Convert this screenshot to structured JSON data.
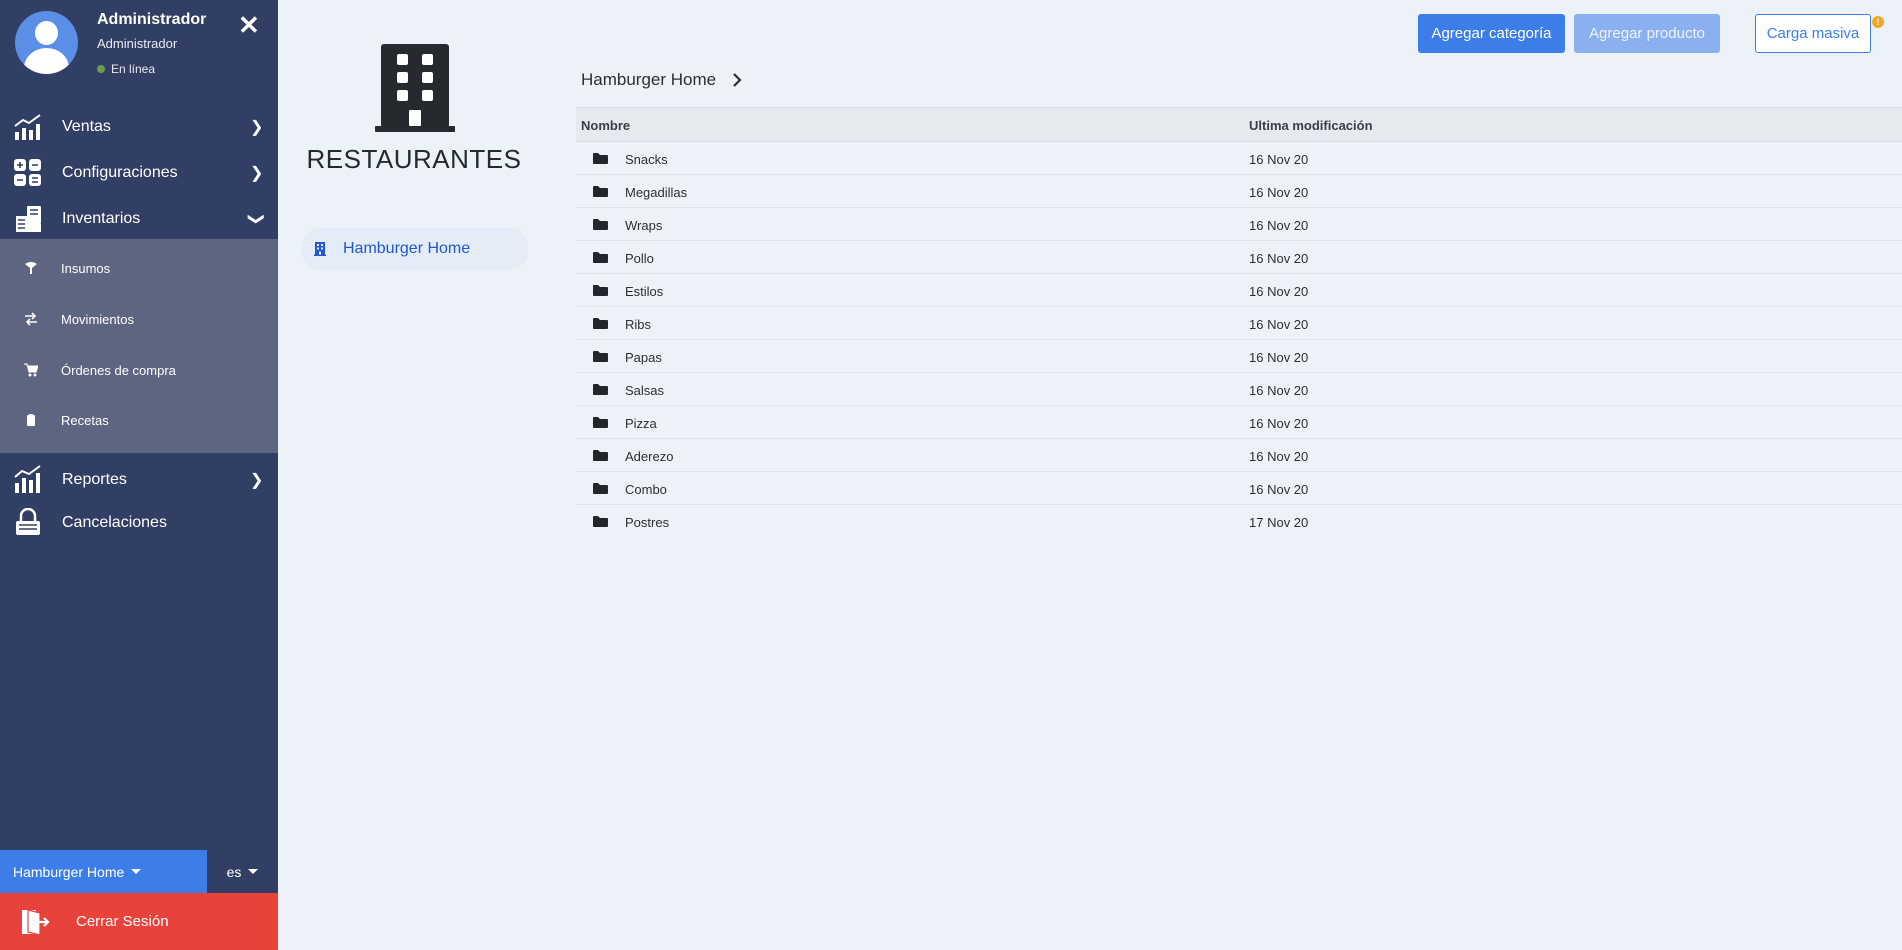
{
  "sidebar": {
    "user_name": "Administrador",
    "user_role": "Administrador",
    "status": "En línea",
    "nav": {
      "ventas": "Ventas",
      "configuraciones": "Configuraciones",
      "inventarios": "Inventarios",
      "reportes": "Reportes",
      "cancelaciones": "Cancelaciones"
    },
    "submenu": {
      "insumos": "Insumos",
      "movimientos": "Movimientos",
      "ordenes": "Órdenes de compra",
      "recetas": "Recetas"
    },
    "restaurant_select": "Hamburger Home",
    "language": "es",
    "logout": "Cerrar Sesión"
  },
  "restaurants": {
    "title": "RESTAURANTES",
    "items": [
      "Hamburger Home"
    ]
  },
  "toolbar": {
    "add_category": "Agregar categoría",
    "add_product": "Agregar producto",
    "bulk_upload": "Carga masiva",
    "info_badge": "!"
  },
  "breadcrumb": {
    "current": "Hamburger Home"
  },
  "table": {
    "columns": [
      "Nombre",
      "Ultima modificación"
    ],
    "rows": [
      {
        "name": "Snacks",
        "modified": "16 Nov 20"
      },
      {
        "name": "Megadillas",
        "modified": "16 Nov 20"
      },
      {
        "name": "Wraps",
        "modified": "16 Nov 20"
      },
      {
        "name": "Pollo",
        "modified": "16 Nov 20"
      },
      {
        "name": "Estilos",
        "modified": "16 Nov 20"
      },
      {
        "name": "Ribs",
        "modified": "16 Nov 20"
      },
      {
        "name": "Papas",
        "modified": "16 Nov 20"
      },
      {
        "name": "Salsas",
        "modified": "16 Nov 20"
      },
      {
        "name": "Pizza",
        "modified": "16 Nov 20"
      },
      {
        "name": "Aderezo",
        "modified": "16 Nov 20"
      },
      {
        "name": "Combo",
        "modified": "16 Nov 20"
      },
      {
        "name": "Postres",
        "modified": "17 Nov 20"
      }
    ]
  },
  "colors": {
    "sidebar": "#323f64",
    "submenu": "#5d6581",
    "accent": "#3d7de8",
    "logout": "#e8423d",
    "background": "#edf1f8"
  }
}
